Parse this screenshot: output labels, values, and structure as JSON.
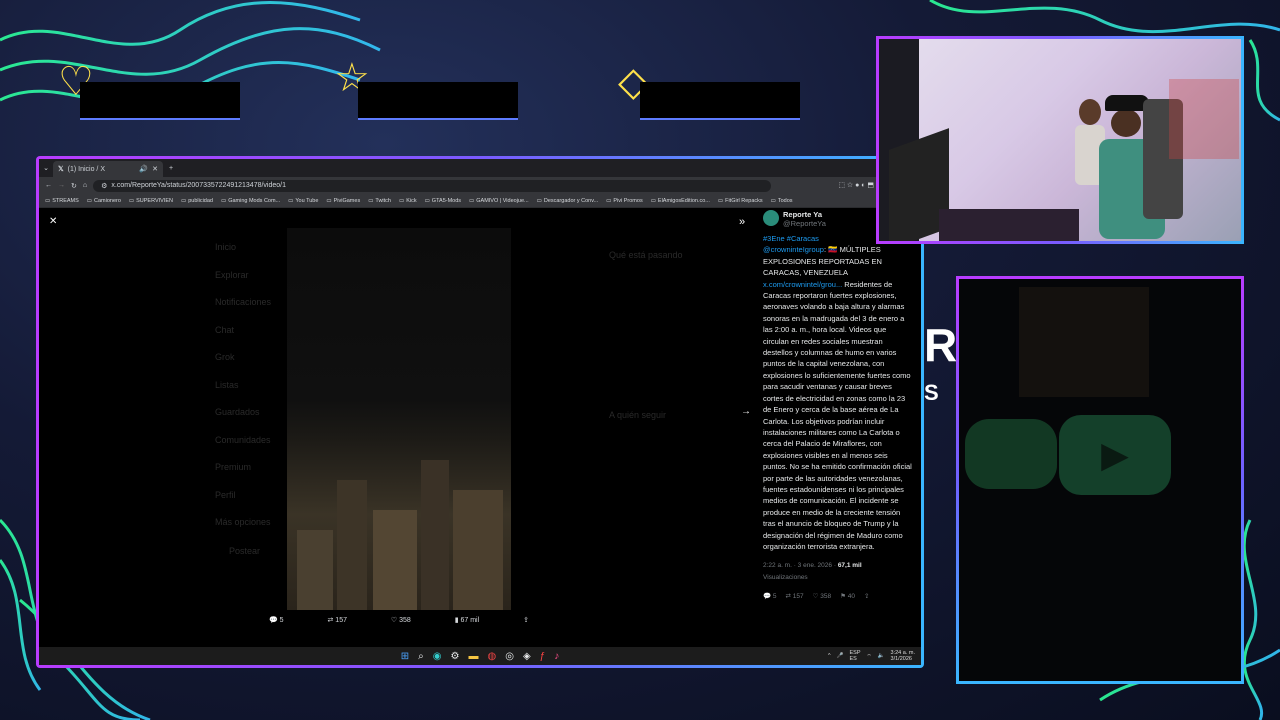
{
  "browser": {
    "tab_title": "(1) Inicio / X",
    "url": "x.com/ReporteYa/status/2007335722491213478/video/1",
    "bookmarks": [
      "STREAMS",
      "Camionero",
      "SUPERVIVIEN",
      "publicidad",
      "Gaming Mods Com...",
      "You Tube",
      "PiviGames",
      "Twitch",
      "Kick",
      "GTA5-Mods",
      "GAMIVO | Videojue...",
      "Descargador y Conv...",
      "Pivi Promos",
      "ElAmigosEdition.co...",
      "FitGirl Repacks",
      "Todos"
    ]
  },
  "video_actions": {
    "replies": "5",
    "reposts": "157",
    "likes": "358",
    "views": "67 mil"
  },
  "tweet": {
    "author": "Reporte Ya",
    "handle": "@ReporteYa",
    "hashtags": "#3Ene #Caracas",
    "mention": "@crowninteIgroup",
    "headline": ": 🇻🇪 MÚLTIPLES EXPLOSIONES REPORTADAS EN CARACAS, VENEZUELA",
    "link": "x.com/crownintel/grou...",
    "body": " Residentes de Caracas reportaron fuertes explosiones, aeronaves volando a baja altura y alarmas sonoras en la madrugada del 3 de enero a las 2:00 a. m., hora local. Videos que circulan en redes sociales muestran destellos y columnas de humo en varios puntos de la capital venezolana, con explosiones lo suficientemente fuertes como para sacudir ventanas y causar breves cortes de electricidad en zonas como la 23 de Enero y cerca de la base aérea de La Carlota. Los objetivos podrían incluir instalaciones militares como La Carlota o cerca del Palacio de Miraflores, con explosiones visibles en al menos seis puntos. No se ha emitido confirmación oficial por parte de las autoridades venezolanas, fuentes estadounidenses ni los principales medios de comunicación. El incidente se produce en medio de la creciente tensión tras el anuncio de bloqueo de Trump y la designación del régimen de Maduro como organización terrorista extranjera.",
    "timestamp": "2:22 a. m. · 3 ene. 2026 ·",
    "views_count": "67,1 mil",
    "views_label": "Visualizaciones",
    "stats": {
      "replies": "5",
      "reposts": "157",
      "likes": "358",
      "bookmarks": "40"
    }
  },
  "ghost_menu": [
    "Inicio",
    "Explorar",
    "Notificaciones",
    "Chat",
    "Grok",
    "Listas",
    "Guardados",
    "Comunidades",
    "Premium",
    "Perfil",
    "Más opciones"
  ],
  "ghost_right": {
    "trending": "Qué está pasando",
    "follow": "A quién seguir",
    "post": "Postear"
  },
  "taskbar": {
    "lang": "ESP",
    "region": "ES",
    "time": "3:24 a. m.",
    "date": "3/1/2026"
  },
  "overlay_brand_letters": {
    "big": "R",
    "small": "S"
  }
}
